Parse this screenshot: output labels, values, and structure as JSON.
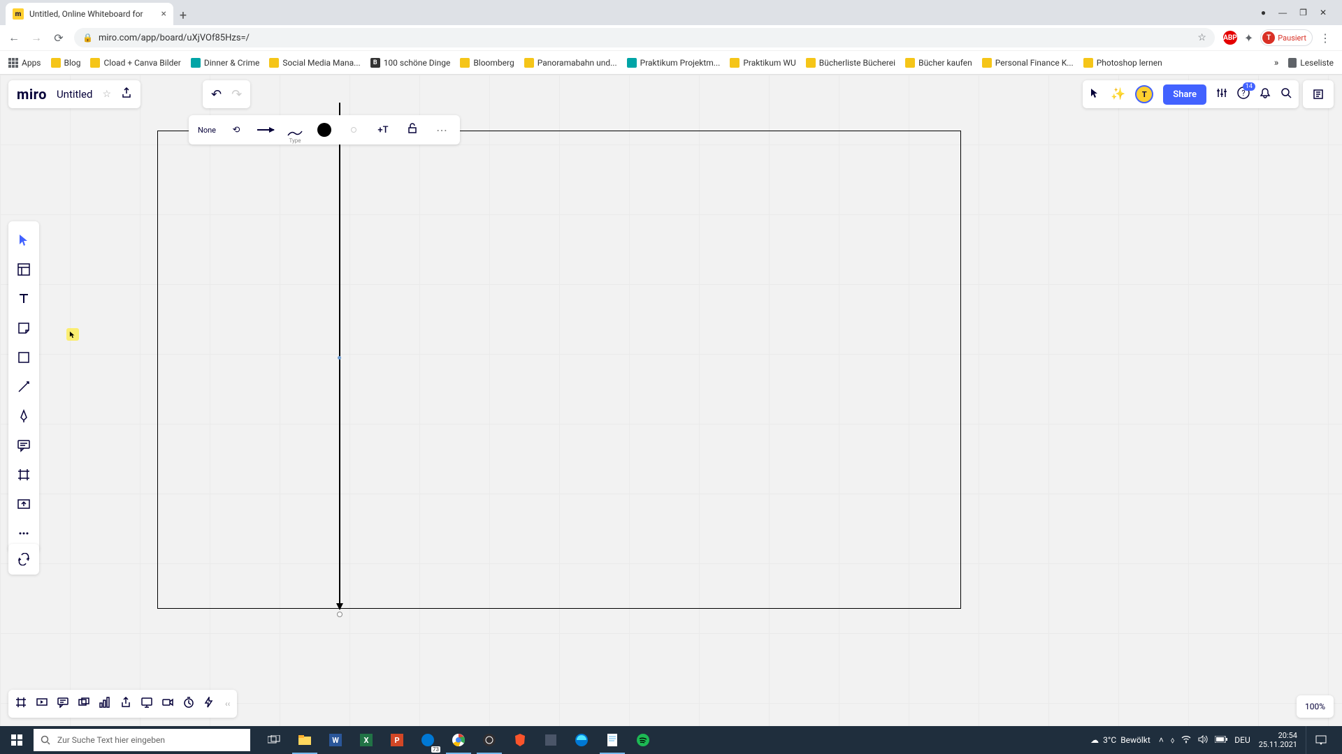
{
  "browser": {
    "tab_title": "Untitled, Online Whiteboard for",
    "url": "miro.com/app/board/uXjVOf85Hzs=/",
    "profile_status": "Pausiert",
    "profile_initial": "T",
    "bookmarks": [
      {
        "label": "Apps",
        "icon": "apps"
      },
      {
        "label": "Blog",
        "icon": "folder"
      },
      {
        "label": "Cload + Canva Bilder",
        "icon": "folder"
      },
      {
        "label": "Dinner & Crime",
        "icon": "teal"
      },
      {
        "label": "Social Media Mana...",
        "icon": "folder"
      },
      {
        "label": "100 schöne Dinge",
        "icon": "dark-b"
      },
      {
        "label": "Bloomberg",
        "icon": "folder"
      },
      {
        "label": "Panoramabahn und...",
        "icon": "folder"
      },
      {
        "label": "Praktikum Projektm...",
        "icon": "teal"
      },
      {
        "label": "Praktikum WU",
        "icon": "folder"
      },
      {
        "label": "Bücherliste Bücherei",
        "icon": "folder"
      },
      {
        "label": "Bücher kaufen",
        "icon": "folder"
      },
      {
        "label": "Personal Finance K...",
        "icon": "folder"
      },
      {
        "label": "Photoshop lernen",
        "icon": "folder"
      }
    ],
    "reading_list": "Leseliste"
  },
  "miro": {
    "logo": "miro",
    "board_title": "Untitled",
    "share": "Share",
    "help_count": "14",
    "zoom": "100%",
    "user_initial": "T",
    "ctx": {
      "start_cap": "None",
      "type_label": "Type"
    }
  },
  "taskbar": {
    "search_placeholder": "Zur Suche Text hier eingeben",
    "weather_temp": "3°C",
    "weather_cond": "Bewölkt",
    "lang": "DEU",
    "time": "20:54",
    "date": "25.11.2021",
    "chrome_badge": "73"
  }
}
